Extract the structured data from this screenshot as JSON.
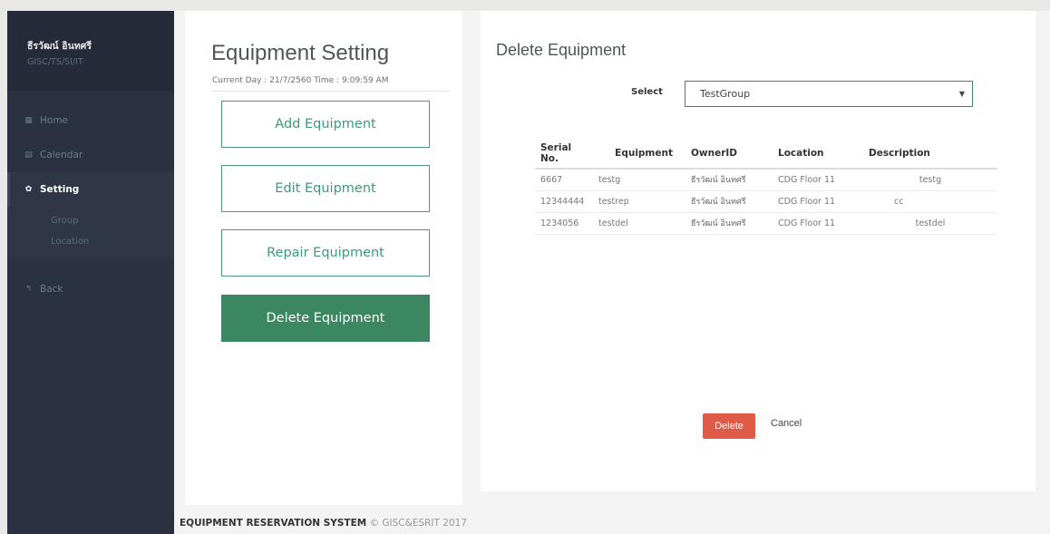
{
  "sidebar": {
    "user_name": "ธีรวัฒน์ อินทศรี",
    "user_org": "GISC/TS/SI/IT",
    "items": {
      "home": {
        "label": "Home",
        "icon": "grid-icon"
      },
      "calendar": {
        "label": "Calendar",
        "icon": "calendar-icon"
      },
      "setting": {
        "label": "Setting",
        "icon": "gear-icon"
      },
      "group": {
        "label": "Group"
      },
      "location": {
        "label": "Location"
      },
      "back": {
        "label": "Back",
        "icon": "reply-icon"
      }
    }
  },
  "settings": {
    "title": "Equipment Setting",
    "current_time": "Current  Day :  21/7/2560  Time :  9:09:59 AM",
    "buttons": {
      "add": "Add Equipment",
      "edit": "Edit Equipment",
      "repair": "Repair Equipment",
      "delete": "Delete Equipment"
    }
  },
  "content": {
    "title": "Delete Equipment",
    "select_label": "Select",
    "select_value": "TestGroup",
    "table": {
      "headers": {
        "serial": "Serial No.",
        "equipment": "Equipment",
        "owner": "OwnerID",
        "location": "Location",
        "description": "Description"
      },
      "rows": [
        {
          "serial": "6667",
          "equipment": "testg",
          "owner": "ธีรวัฒน์ อินทศรี",
          "location": "CDG Floor 11",
          "description": "testg"
        },
        {
          "serial": "12344444",
          "equipment": "testrep",
          "owner": "ธีรวัฒน์ อินทศรี",
          "location": "CDG Floor 11",
          "description": "cc"
        },
        {
          "serial": "1234056",
          "equipment": "testdel",
          "owner": "ธีรวัฒน์ อินทศรี",
          "location": "CDG Floor 11",
          "description": "testdel"
        }
      ]
    },
    "delete_label": "Delete",
    "cancel_label": "Cancel"
  },
  "footer": {
    "system": "EQUIPMENT RESERVATION SYSTEM",
    "copyright": "© GISC&ESRIT 2017"
  },
  "colors": {
    "sidebar": "#2a3140",
    "accent_green": "#3b8762",
    "delete_red": "#e05a48"
  }
}
